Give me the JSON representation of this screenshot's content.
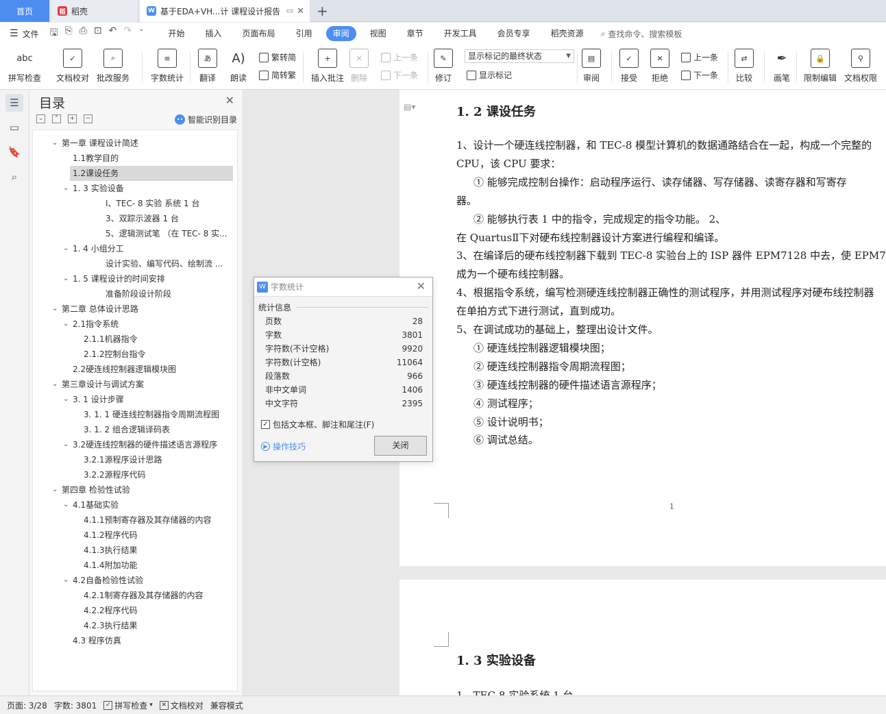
{
  "tabs": {
    "home": "首页",
    "daoke": "稻壳",
    "doc": "基于EDA+VH...计 课程设计报告"
  },
  "menubar": {
    "file": "文件",
    "menus": [
      "开始",
      "插入",
      "页面布局",
      "引用",
      "审阅",
      "视图",
      "章节",
      "开发工具",
      "会员专享",
      "稻壳资源"
    ],
    "active_menu": "审阅",
    "search": "查找命令、搜索模板"
  },
  "ribbon": {
    "spell": "拼写检查",
    "proof": "文档校对",
    "batch": "批改服务",
    "wordcount": "字数统计",
    "translate": "翻译",
    "read": "朗读",
    "trad": "繁转简",
    "simp": "简转繁",
    "insert_comment": "插入批注",
    "delete": "删除",
    "prev_c": "上一条",
    "next_c": "下一条",
    "revise": "修订",
    "markup_state": "显示标记的最终状态",
    "show_markup": "显示标记",
    "review": "审阅",
    "accept": "接受",
    "reject": "拒绝",
    "prev": "上一条",
    "next": "下一条",
    "compare": "比较",
    "pen": "画笔",
    "restrict": "限制编辑",
    "rights": "文档权限",
    "abc": "abc"
  },
  "toc": {
    "title": "目录",
    "smart": "智能识别目录",
    "items": [
      {
        "label": "第一章 课程设计简述",
        "level": 1,
        "chev": "v"
      },
      {
        "label": "1.1教学目的",
        "level": 2,
        "chev": ""
      },
      {
        "label": "1.2课设任务",
        "level": 2,
        "chev": "",
        "selected": true
      },
      {
        "label": "1. 3  实验设备",
        "level": 2,
        "chev": "v"
      },
      {
        "label": "Ⅰ、TEC- 8 实验 系统  1 台",
        "level": 4,
        "chev": ""
      },
      {
        "label": "3、双踪示波器 1 台",
        "level": 4,
        "chev": ""
      },
      {
        "label": "5、逻辑测试笔  （在 TEC- 8 实...",
        "level": 4,
        "chev": ""
      },
      {
        "label": "1. 4  小组分工",
        "level": 2,
        "chev": "v"
      },
      {
        "label": "设计实验、编写代码、绘制流 ...",
        "level": 4,
        "chev": ""
      },
      {
        "label": "1. 5  课程设计的时间安排",
        "level": 2,
        "chev": "v"
      },
      {
        "label": "准备阶段设计阶段",
        "level": 4,
        "chev": ""
      },
      {
        "label": "第二章 总体设计思路",
        "level": 1,
        "chev": "v"
      },
      {
        "label": "2.1指令系统",
        "level": 2,
        "chev": "v"
      },
      {
        "label": "2.1.1机器指令",
        "level": 3,
        "chev": ""
      },
      {
        "label": "2.1.2控制台指令",
        "level": 3,
        "chev": ""
      },
      {
        "label": "2.2硬连线控制器逻辑模块图",
        "level": 2,
        "chev": ""
      },
      {
        "label": "第三章设计与调试方案",
        "level": 1,
        "chev": "v"
      },
      {
        "label": "3. 1  设计步骤",
        "level": 2,
        "chev": "v"
      },
      {
        "label": "3. 1. 1  硬连线控制器指令周期流程图",
        "level": 3,
        "chev": ""
      },
      {
        "label": "3. 1. 2  组合逻辑译码表",
        "level": 3,
        "chev": ""
      },
      {
        "label": "3.2硬连线控制器的硬件描述语言源程序",
        "level": 2,
        "chev": "v"
      },
      {
        "label": "3.2.1源程序设计思路",
        "level": 3,
        "chev": ""
      },
      {
        "label": "3.2.2源程序代码",
        "level": 3,
        "chev": ""
      },
      {
        "label": "第四章 检验性试验",
        "level": 1,
        "chev": "v"
      },
      {
        "label": "4.1基础实验",
        "level": 2,
        "chev": "v"
      },
      {
        "label": "4.1.1预制寄存器及其存储器的内容",
        "level": 3,
        "chev": ""
      },
      {
        "label": "4.1.2程序代码",
        "level": 3,
        "chev": ""
      },
      {
        "label": "4.1.3执行结果",
        "level": 3,
        "chev": ""
      },
      {
        "label": "4.1.4附加功能",
        "level": 3,
        "chev": ""
      },
      {
        "label": "4.2自备检验性试验",
        "level": 2,
        "chev": "v"
      },
      {
        "label": "4.2.1制寄存器及其存储器的内容",
        "level": 3,
        "chev": ""
      },
      {
        "label": "4.2.2程序代码",
        "level": 3,
        "chev": ""
      },
      {
        "label": "4.2.3执行结果",
        "level": 3,
        "chev": ""
      },
      {
        "label": "4.3 程序仿真",
        "level": 2,
        "chev": ""
      }
    ]
  },
  "document": {
    "heading": "1. 2  课设任务",
    "lines": [
      "1、设计一个硬连线控制器，和 TEC-8 模型计算机的数据通路结合在一起，构成一个完整的",
      "CPU，该 CPU 要求：",
      "① 能够完成控制台操作：启动程序运行、读存储器、写存储器、读寄存器和写寄存",
      "器。",
      "②  能够执行表  1  中的指令，完成规定的指令功能。 2、",
      "在 QuartusⅡ下对硬布线控制器设计方案进行编程和编译。",
      "3、在编译后的硬布线控制器下载到 TEC-8 实验台上的 ISP 器件 EPM7128 中去，使 EPM7",
      "成为一个硬布线控制器。",
      "4、根据指令系统，编写检测硬连线控制器正确性的测试程序，并用测试程序对硬布线控制器",
      "在单拍方式下进行测试，直到成功。",
      "5、在调试成功的基础上，整理出设计文件。",
      "① 硬连线控制器逻辑模块图；",
      "② 硬连线控制器指令周期流程图；",
      "③ 硬连线控制器的硬件描述语言源程序；",
      "④ 测试程序；",
      "⑤ 设计说明书；",
      "⑥ 调试总结。"
    ],
    "page_number": "1",
    "heading2": "1. 3   实验设备",
    "partial": "1、TEC-8 实验系统                                    1 台"
  },
  "dialog": {
    "title": "字数统计",
    "section": "统计信息",
    "stats": [
      {
        "label": "页数",
        "value": "28"
      },
      {
        "label": "字数",
        "value": "3801"
      },
      {
        "label": "字符数(不计空格)",
        "value": "9920"
      },
      {
        "label": "字符数(计空格)",
        "value": "11064"
      },
      {
        "label": "段落数",
        "value": "966"
      },
      {
        "label": "非中文单词",
        "value": "1406"
      },
      {
        "label": "中文字符",
        "value": "2395"
      }
    ],
    "checkbox": "包括文本框、脚注和尾注(F)",
    "tips": "操作技巧",
    "close": "关闭"
  },
  "status": {
    "page": "页面: 3/28",
    "words": "字数: 3801",
    "spell": "拼写检查",
    "proof": "文档校对",
    "mode": "兼容模式"
  }
}
